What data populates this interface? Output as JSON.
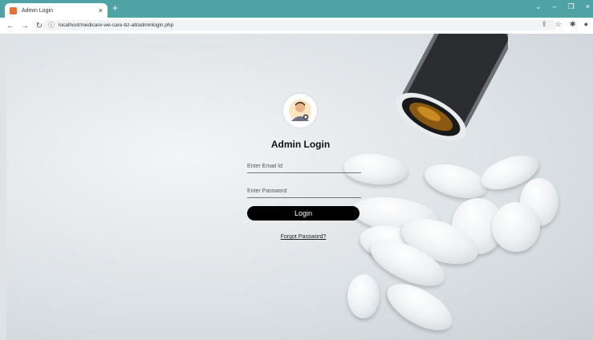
{
  "browser": {
    "tab_title": "Admin Login",
    "tab_close": "×",
    "new_tab": "+",
    "url": "localhost/medicare-we-care-bz-all/adminlogin.php",
    "window_controls": [
      "⌄",
      "–",
      "❐",
      "×"
    ],
    "nav_icons": [
      "back-icon",
      "forward-icon",
      "reload-icon",
      "home-icon"
    ]
  },
  "login": {
    "title": "Admin Login",
    "email_placeholder": "Enter Email Id",
    "password_placeholder": "Enter Password",
    "button_label": "Login",
    "forgot_link": "Forgot Password?"
  },
  "colors": {
    "tab_bar": "#4fa3a5",
    "button": "#000000",
    "favicon": "#e8703a"
  }
}
